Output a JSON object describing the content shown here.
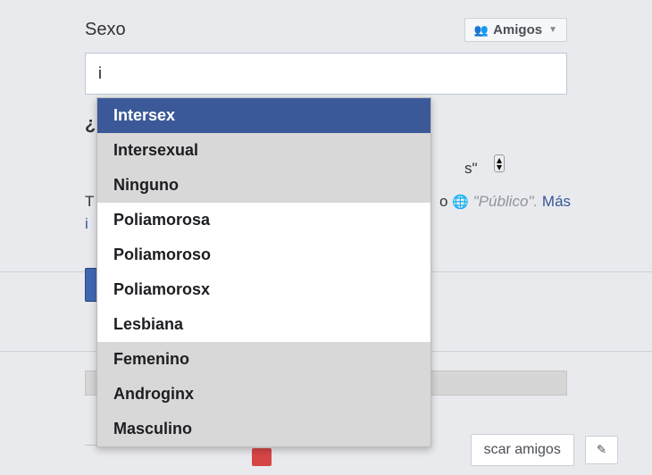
{
  "field_label": "Sexo",
  "privacy": {
    "label": "Amigos"
  },
  "input": {
    "value": "i"
  },
  "background": {
    "question_prefix": "¿",
    "truncated_t": "T",
    "truncated_o": "o",
    "truncated_i": "i",
    "select_trailing": "s\"",
    "globe_label": "\"Público\".",
    "mas_link": "Más"
  },
  "dropdown": {
    "options": [
      {
        "label": "Intersex",
        "state": "highlighted"
      },
      {
        "label": "Intersexual",
        "state": "shaded"
      },
      {
        "label": "Ninguno",
        "state": "shaded"
      },
      {
        "label": "Poliamorosa",
        "state": "normal"
      },
      {
        "label": "Poliamoroso",
        "state": "normal"
      },
      {
        "label": "Poliamorosx",
        "state": "normal"
      },
      {
        "label": "Lesbiana",
        "state": "normal"
      },
      {
        "label": "Femenino",
        "state": "shaded"
      },
      {
        "label": "Androginx",
        "state": "shaded"
      },
      {
        "label": "Masculino",
        "state": "shaded"
      }
    ]
  },
  "bottom": {
    "search_friends": "scar amigos",
    "edit_icon": "✎"
  }
}
